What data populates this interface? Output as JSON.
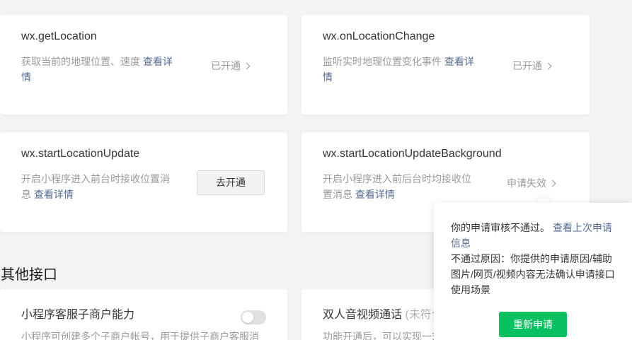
{
  "cards": [
    {
      "title": "wx.getLocation",
      "desc": "获取当前的地理位置、速度",
      "link": "查看详情",
      "status": "已开通"
    },
    {
      "title": "wx.onLocationChange",
      "desc": "监听实时地理位置变化事件",
      "link": "查看详情",
      "status": "已开通"
    },
    {
      "title": "wx.startLocationUpdate",
      "desc": "开启小程序进入前台时接收位置消息",
      "link": "查看详情",
      "button": "去开通"
    },
    {
      "title": "wx.startLocationUpdateBackground",
      "desc": "开启小程序进入前后台时均接收位置消息",
      "link": "查看详情",
      "status": "申请失效"
    }
  ],
  "other_section": {
    "title": "其他接口",
    "cards": [
      {
        "title": "小程序客服子商户能力",
        "desc": "小程序可创建多个子商户帐号，用于提供子商户客服消"
      },
      {
        "title": "双人音视频通话",
        "title_note": "(未符合",
        "desc": "功能开通后，可以实现一对"
      }
    ]
  },
  "popover": {
    "line1": "你的申请审核不通过。",
    "link": "查看上次申请信息",
    "reason": "不通过原因：你提供的申请原因/辅助图片/网页/视频内容无法确认申请接口使用场景",
    "button": "重新申请"
  },
  "colors": {
    "accent": "#07c160",
    "link": "#576b95",
    "muted": "#9a9a9a",
    "background": "#f3f3f5"
  }
}
